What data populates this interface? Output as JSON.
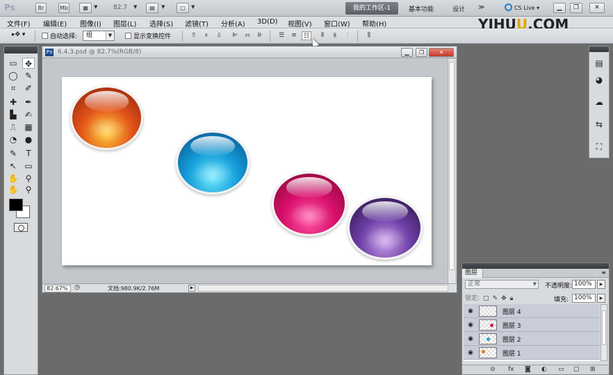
{
  "appbar": {
    "logo": "Ps",
    "btn_br": "Br",
    "btn_mb": "Mb",
    "zoom": "82.7",
    "workspace_active": "我的工作区-1",
    "workspace_basic": "基本功能",
    "workspace_design": "设计",
    "more": "≫",
    "cslive": "CS Live"
  },
  "menu": {
    "items": [
      "文件(F)",
      "编辑(E)",
      "图像(I)",
      "图层(L)",
      "选择(S)",
      "滤镜(T)",
      "分析(A)",
      "3D(D)",
      "视图(V)",
      "窗口(W)",
      "帮助(H)"
    ]
  },
  "watermark": {
    "part1": "YIHU",
    "part2": "U",
    "part3": ".COM"
  },
  "options": {
    "auto_select_label": "自动选择:",
    "auto_select_value": "组",
    "show_transform_label": "显示变换控件"
  },
  "tools": {
    "items": [
      "▭",
      "✥",
      "◯",
      "✎",
      "⌗",
      "✐",
      "✚",
      "✒",
      "▙",
      "✍",
      "⎍",
      "▦",
      "◔",
      "●",
      "✎",
      "T",
      "↖",
      "▭",
      "✋",
      "⚲",
      "✋",
      "⚲"
    ]
  },
  "document": {
    "title": "6.4.3.psd @ 82.7%(RGB/8)",
    "status_zoom": "82.67%",
    "status_doc": "文档:980.9K/2.76M"
  },
  "spheres": [
    {
      "name": "orange-sphere",
      "color_light": "#ffcf3a",
      "color_mid": "#e2541a",
      "color_dark": "#8a1d0a"
    },
    {
      "name": "cyan-sphere",
      "color_light": "#6fe8ff",
      "color_mid": "#139cd8",
      "color_dark": "#0c4c86"
    },
    {
      "name": "magenta-sphere",
      "color_light": "#ff5aa8",
      "color_mid": "#d80f6b",
      "color_dark": "#7c0731"
    },
    {
      "name": "purple-sphere",
      "color_light": "#c99dea",
      "color_mid": "#6c3ea5",
      "color_dark": "#23123c"
    }
  ],
  "right_dock": {
    "icons": [
      "▤",
      "◕",
      "☁",
      "⇆",
      "⛶"
    ]
  },
  "layers": {
    "tab": "图层",
    "blend_mode": "正常",
    "opacity_label": "不透明度:",
    "opacity_value": "100%",
    "lock_label": "锁定:",
    "fill_label": "填充:",
    "fill_value": "100%",
    "rows": [
      {
        "name": "图层 4",
        "dot": ""
      },
      {
        "name": "图层 3",
        "dot": "#d8125f"
      },
      {
        "name": "图层 2",
        "dot": "#1aa5d8"
      },
      {
        "name": "图层 1",
        "dot": "#e47a16"
      }
    ],
    "bottom_icons": [
      "⊝",
      "fx",
      "◙",
      "◐",
      "▭",
      "▢",
      "⊞"
    ]
  }
}
